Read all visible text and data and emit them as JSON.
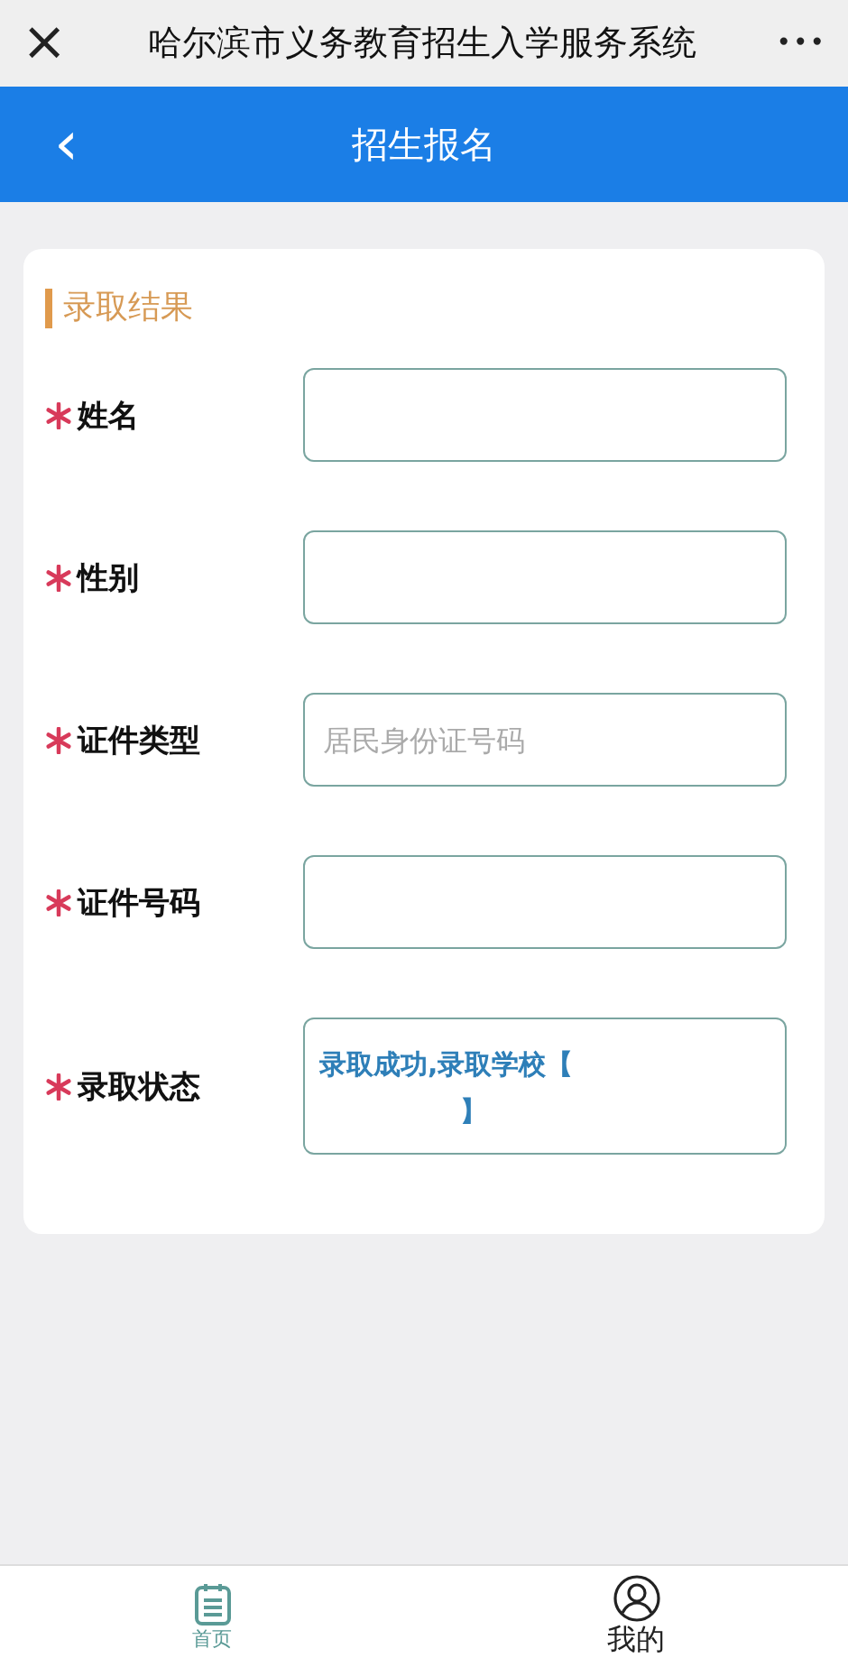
{
  "window": {
    "title": "哈尔滨市义务教育招生入学服务系统",
    "close": "×",
    "more": "•••"
  },
  "header": {
    "back": "‹",
    "title": "招生报名"
  },
  "section": {
    "title": "录取结果"
  },
  "fields": [
    {
      "kind": "input",
      "required": true,
      "label": "姓名"
    },
    {
      "kind": "input",
      "required": true,
      "label": "性别"
    },
    {
      "kind": "input",
      "required": true,
      "label": "证件类型",
      "placeholder": "居民身份证号码"
    },
    {
      "kind": "input",
      "required": true,
      "label": "证件号码"
    },
    {
      "kind": "status",
      "required": true,
      "label": "录取状态",
      "value_lines": [
        "录取成功,录取学校【",
        "】"
      ]
    }
  ],
  "tabs": [
    {
      "label": "首页",
      "selected": true
    },
    {
      "label": "我的",
      "selected": false
    }
  ]
}
